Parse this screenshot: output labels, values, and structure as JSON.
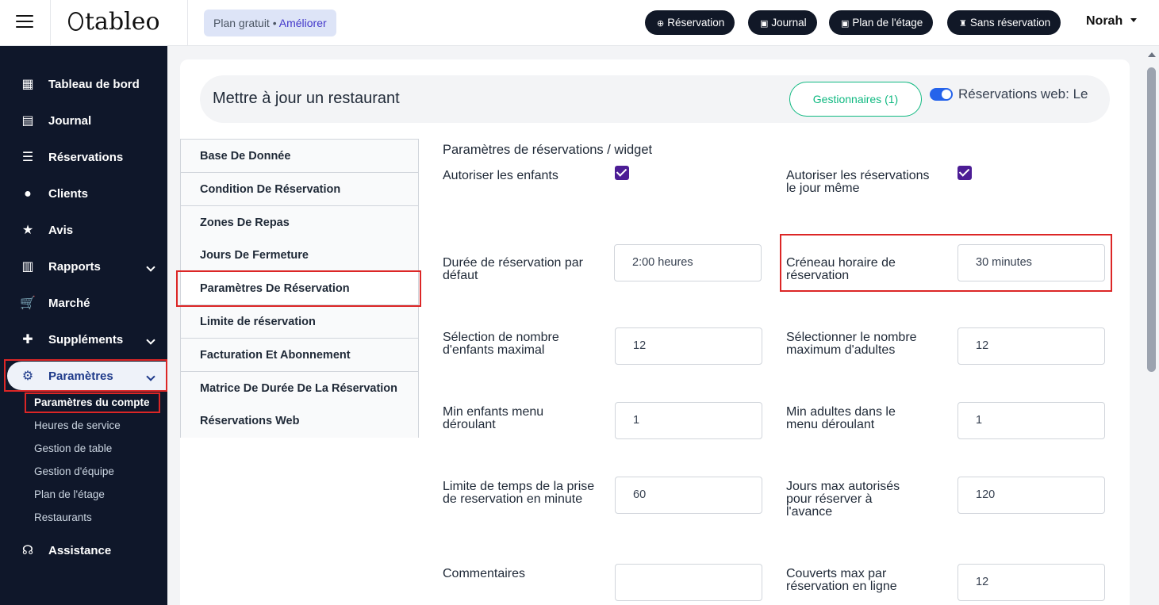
{
  "brand": {
    "logo_text": "tableo"
  },
  "plan": {
    "label": "Plan gratuit • ",
    "upgrade": "Améliorer"
  },
  "top_actions": [
    {
      "label": "Réservation",
      "icon": "plus-circle-icon"
    },
    {
      "label": "Journal",
      "icon": "calendar-icon"
    },
    {
      "label": "Plan de l'étage",
      "icon": "calendar-icon"
    },
    {
      "label": "Sans réservation",
      "icon": "walk-in-icon"
    }
  ],
  "user": {
    "name": "Norah"
  },
  "sidebar": {
    "items": [
      {
        "label": "Tableau de bord",
        "icon": "dashboard-icon"
      },
      {
        "label": "Journal",
        "icon": "book-icon"
      },
      {
        "label": "Réservations",
        "icon": "list-icon"
      },
      {
        "label": "Clients",
        "icon": "user-icon"
      },
      {
        "label": "Avis",
        "icon": "star-icon"
      },
      {
        "label": "Rapports",
        "icon": "chart-icon"
      },
      {
        "label": "Marché",
        "icon": "cart-icon"
      },
      {
        "label": "Suppléments",
        "icon": "puzzle-icon"
      },
      {
        "label": "Paramètres",
        "icon": "gear-icon"
      },
      {
        "label": "Assistance",
        "icon": "headset-icon"
      }
    ],
    "sub_items": [
      {
        "label": "Paramètres du compte"
      },
      {
        "label": "Heures de service"
      },
      {
        "label": "Gestion de table"
      },
      {
        "label": "Gestion d'équipe"
      },
      {
        "label": "Plan de l'étage"
      },
      {
        "label": "Restaurants"
      }
    ]
  },
  "header": {
    "title": "Mettre à jour un restaurant",
    "managers_button": "Gestionnaires (1)",
    "web_reservations": "Réservations web: Le"
  },
  "menu": [
    {
      "label": "Base De Donnée"
    },
    {
      "label": "Condition De Réservation"
    },
    {
      "label": "Zones De Repas"
    },
    {
      "label": "Jours De Fermeture"
    },
    {
      "label": "Paramètres De Réservation"
    },
    {
      "label": "Limite de réservation"
    },
    {
      "label": "Facturation Et Abonnement"
    },
    {
      "label": "Matrice De Durée De La Réservation"
    },
    {
      "label": "Réservations Web"
    }
  ],
  "form": {
    "section_title": "Paramètres de réservations / widget",
    "allow_children": {
      "label": "Autoriser les enfants",
      "checked": true
    },
    "allow_same_day": {
      "label": "Autoriser les réservations le jour même",
      "checked": true
    },
    "default_duration": {
      "label": "Durée de réservation par défaut",
      "value": "2:00 heures"
    },
    "time_slot": {
      "label": "Créneau horaire de réservation",
      "value": "30 minutes"
    },
    "max_children": {
      "label": "Sélection de nombre d'enfants maximal",
      "value": "12"
    },
    "max_adults": {
      "label": "Sélectionner le nombre maximum d'adultes",
      "value": "12"
    },
    "min_children": {
      "label": "Min enfants menu déroulant",
      "value": "1"
    },
    "min_adults": {
      "label": "Min adultes dans le menu déroulant",
      "value": "1"
    },
    "time_limit": {
      "label": "Limite de temps de la prise de reservation en minute",
      "value": "60"
    },
    "max_days": {
      "label": "Jours max autorisés pour réserver à l'avance",
      "value": "120"
    },
    "comments": {
      "label": "Commentaires",
      "value": ""
    },
    "max_covers": {
      "label": "Couverts max par réservation en ligne",
      "value": "12"
    }
  },
  "colors": {
    "sidebar_bg": "#0f172a",
    "accent": "#10b981",
    "highlight": "#dc2626",
    "checkbox": "#4c1d95"
  }
}
